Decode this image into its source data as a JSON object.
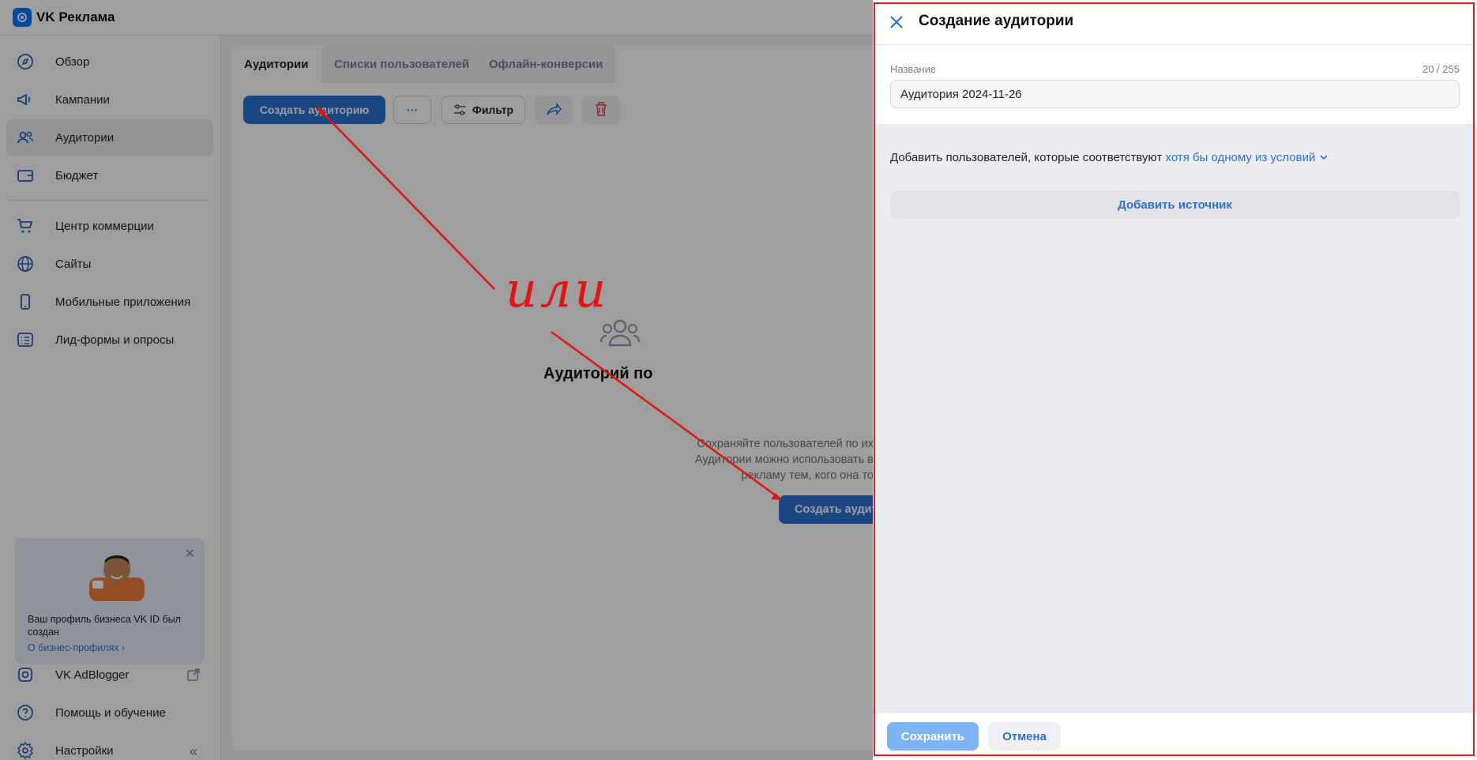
{
  "app": {
    "name": "VK Реклама"
  },
  "sidebar": {
    "items": [
      {
        "label": "Обзор",
        "icon": "compass-icon"
      },
      {
        "label": "Кампании",
        "icon": "megaphone-icon"
      },
      {
        "label": "Аудитории",
        "icon": "users-icon",
        "active": true
      },
      {
        "label": "Бюджет",
        "icon": "wallet-icon"
      },
      {
        "label": "Центр коммерции",
        "icon": "cart-icon"
      },
      {
        "label": "Сайты",
        "icon": "globe-icon"
      },
      {
        "label": "Мобильные приложения",
        "icon": "phone-icon"
      },
      {
        "label": "Лид-формы и опросы",
        "icon": "list-icon"
      }
    ],
    "promo": {
      "text": "Ваш профиль бизнеса VK ID был создан",
      "link": "О бизнес-профилях ›"
    },
    "bottom_items": [
      {
        "label": "VK AdBlogger",
        "icon": "adblogger-icon"
      },
      {
        "label": "Помощь и обучение",
        "icon": "help-icon"
      },
      {
        "label": "Настройки",
        "icon": "gear-icon"
      }
    ]
  },
  "main": {
    "tabs": [
      {
        "label": "Аудитории",
        "active": true
      },
      {
        "label": "Списки пользователей"
      },
      {
        "label": "Офлайн-конверсии"
      }
    ],
    "toolbar": {
      "create_label": "Создать аудиторию",
      "more_label": "···",
      "filter_label": "Фильтр"
    },
    "empty_state": {
      "title": "Аудиторий по",
      "desc_line1": "Сохраняйте пользователей по их",
      "desc_line2": "Аудитории можно использовать в",
      "desc_line3": "рекламу тем, кого она то",
      "cta_label": "Создать аудит"
    }
  },
  "annotation": {
    "handwritten_text": "или"
  },
  "drawer": {
    "title": "Создание аудитории",
    "name_label": "Название",
    "name_counter": "20 / 255",
    "name_value": "Аудитория 2024-11-26",
    "condition_text": "Добавить пользователей, которые соответствуют",
    "condition_link": "хотя бы одному из условий",
    "add_source_label": "Добавить источник",
    "save_label": "Сохранить",
    "cancel_label": "Отмена"
  },
  "colors": {
    "accent": "#2b71d1",
    "annotation_red": "#e11414"
  }
}
